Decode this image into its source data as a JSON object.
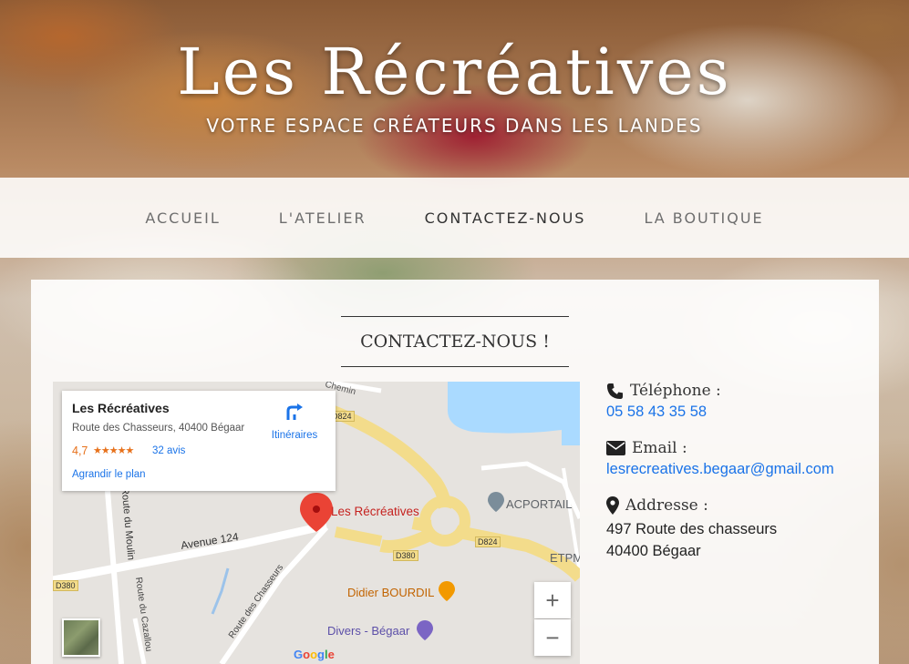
{
  "header": {
    "title": "Les Récréatives",
    "tagline": "VOTRE ESPACE CRÉATEURS DANS LES LANDES"
  },
  "nav": {
    "items": [
      "ACCUEIL",
      "L'ATELIER",
      "CONTACTEZ-NOUS",
      "LA BOUTIQUE"
    ],
    "active": "CONTACTEZ-NOUS"
  },
  "section": {
    "title": "CONTACTEZ-NOUS !"
  },
  "map": {
    "card": {
      "name": "Les Récréatives",
      "address": "Route des Chasseurs, 40400 Bégaar",
      "rating": "4,7",
      "stars": "★★★★★",
      "reviews": "32 avis",
      "enlarge": "Agrandir le plan",
      "directions": "Itinéraires"
    },
    "pin_label": "Les Récréatives",
    "places": {
      "acportail": "ACPORTAIL",
      "etpm": "ETPM",
      "didier": "Didier BOURDIL",
      "divers": "Divers - Bégaar"
    },
    "roads": {
      "avenue": "Avenue 124",
      "moulin": "Route du Moulin",
      "chasseurs": "Route des Chasseurs",
      "cazalloux": "Route du Cazallou",
      "chemin": "Chemin",
      "d824_a": "D824",
      "d824_b": "D824",
      "d380_a": "D380",
      "d380_b": "D380"
    },
    "zoom_in": "+",
    "zoom_out": "−",
    "google": "Google",
    "colors": {
      "road_major": "#f3dc8b",
      "water": "#aadaff",
      "pin": "#ea4335"
    }
  },
  "contact": {
    "phone_label": "Téléphone :",
    "phone": "05 58 43 35 58",
    "email_label": "Email :",
    "email": "lesrecreatives.begaar@gmail.com",
    "address_label": "Addresse :",
    "address_line1": "497 Route des chasseurs",
    "address_line2": "40400 Bégaar",
    "icons": [
      "phone-icon",
      "envelope-icon",
      "map-marker-icon"
    ]
  }
}
